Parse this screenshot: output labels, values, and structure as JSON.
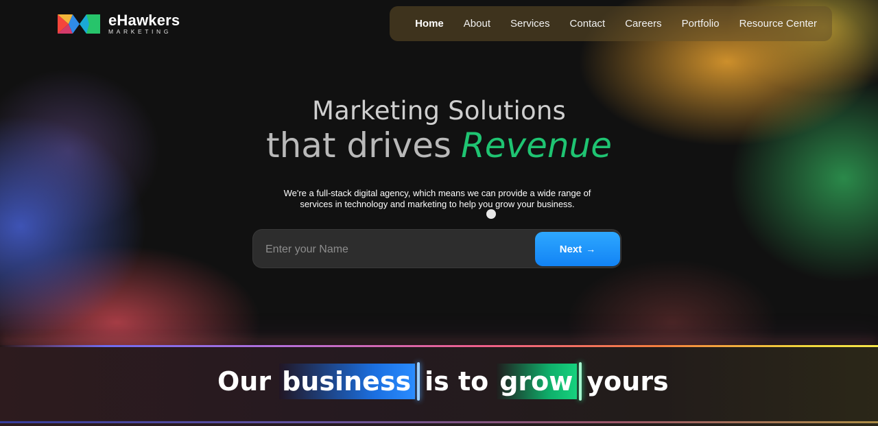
{
  "brand": {
    "name": "eHawkers",
    "subtitle": "MARKETING",
    "logo_colors": [
      "#f5453b",
      "#2f8be8",
      "#27c46b",
      "#f4b63a"
    ]
  },
  "nav": {
    "items": [
      {
        "label": "Home",
        "active": true
      },
      {
        "label": "About",
        "active": false
      },
      {
        "label": "Services",
        "active": false
      },
      {
        "label": "Contact",
        "active": false
      },
      {
        "label": "Careers",
        "active": false
      },
      {
        "label": "Portfolio",
        "active": false
      },
      {
        "label": "Resource Center",
        "active": false
      }
    ]
  },
  "hero": {
    "line1": "Marketing Solutions",
    "line2_plain": "that drives",
    "line2_accent": "Revenue",
    "description_line1": "We're a full-stack digital agency, which means we can provide a wide range of",
    "description_line2": "services in technology and marketing to help you grow your business."
  },
  "form": {
    "name_placeholder": "Enter your Name",
    "name_value": "",
    "next_label": "Next",
    "next_arrow": "→"
  },
  "tagline": {
    "word1": "Our",
    "highlight1": "business",
    "word2": "is to",
    "highlight2": "grow",
    "word3": "yours"
  },
  "colors": {
    "accent_green": "#1fc472",
    "button_blue": "#1a8cff",
    "background": "#111111"
  }
}
